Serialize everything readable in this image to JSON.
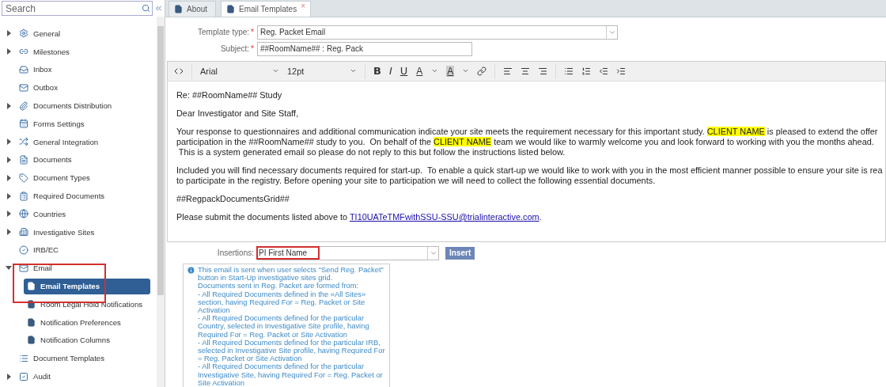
{
  "sidebar": {
    "search": {
      "placeholder": "Search"
    },
    "items": [
      {
        "label": "General",
        "expandable": true,
        "expanded": false,
        "selected": false
      },
      {
        "label": "Milestones",
        "expandable": true,
        "expanded": false,
        "selected": false
      },
      {
        "label": "Inbox",
        "expandable": false,
        "selected": false
      },
      {
        "label": "Outbox",
        "expandable": false,
        "selected": false
      },
      {
        "label": "Documents Distribution",
        "expandable": true,
        "expanded": false,
        "selected": false
      },
      {
        "label": "Forms Settings",
        "expandable": false,
        "selected": false
      },
      {
        "label": "General Integration",
        "expandable": true,
        "expanded": false,
        "selected": false
      },
      {
        "label": "Documents",
        "expandable": true,
        "expanded": false,
        "selected": false
      },
      {
        "label": "Document Types",
        "expandable": true,
        "expanded": false,
        "selected": false
      },
      {
        "label": "Required Documents",
        "expandable": true,
        "expanded": false,
        "selected": false
      },
      {
        "label": "Countries",
        "expandable": true,
        "expanded": false,
        "selected": false
      },
      {
        "label": "Investigative Sites",
        "expandable": true,
        "expanded": false,
        "selected": false
      },
      {
        "label": "IRB/EC",
        "expandable": false,
        "selected": false
      },
      {
        "label": "Email",
        "expandable": true,
        "expanded": true,
        "selected": false,
        "annotated": true,
        "children": [
          {
            "label": "Email Templates",
            "selected": true
          },
          {
            "label": "Room Legal Hold Notifications",
            "selected": false
          },
          {
            "label": "Notification Preferences",
            "selected": false
          },
          {
            "label": "Notification Columns",
            "selected": false
          }
        ]
      },
      {
        "label": "Document Templates",
        "expandable": false,
        "selected": false
      },
      {
        "label": "Audit",
        "expandable": true,
        "expanded": false,
        "selected": false
      }
    ]
  },
  "tabs": [
    {
      "label": "About",
      "selected": false,
      "closable": false
    },
    {
      "label": "Email Templates",
      "selected": true,
      "closable": true,
      "close": "×"
    }
  ],
  "form": {
    "template_type": {
      "label": "Template type:",
      "required": "*",
      "value": "Reg. Packet Email"
    },
    "subject": {
      "label": "Subject:",
      "required": "*",
      "value": "##RoomName## : Reg. Pack"
    }
  },
  "toolbar": {
    "font": "Arial",
    "size": "12pt",
    "bold": "B",
    "italic": "I",
    "underline": "U",
    "text_color": "A",
    "back_color": "A"
  },
  "body": [
    {
      "lines": [
        [
          {
            "text": "Re: ##RoomName## Study"
          }
        ]
      ]
    },
    {
      "lines": [
        [
          {
            "text": "Dear Investigator and Site Staff,"
          }
        ]
      ]
    },
    {
      "lines": [
        [
          {
            "text": "Your response to questionnaires and additional communication indicate your site meets the requirement necessary for this important study. "
          },
          {
            "text": "CLIENT NAME",
            "highlight": true
          },
          {
            "text": " is pleased to extend the offer"
          }
        ],
        [
          {
            "text": "participation in the ##RoomName## study to you.  On behalf of the "
          },
          {
            "text": "CLIENT NAME",
            "highlight": true
          },
          {
            "text": " team we would like to warmly welcome you and look forward to working with you the months ahead."
          }
        ],
        [
          {
            "text": " This is a system generated email so please do not reply to this but follow the instructions listed below."
          }
        ]
      ]
    },
    {
      "lines": [
        [
          {
            "text": "Included you will find necessary documents required for start-up.  To enable a quick start-up we would like to work with you in the most efficient manner possible to ensure your site is rea"
          }
        ],
        [
          {
            "text": "to participate in the registry. Before opening your site to participation we will need to collect the following essential documents."
          }
        ]
      ]
    },
    {
      "lines": [
        [
          {
            "text": "##RegpackDocumentsGrid##"
          }
        ]
      ]
    },
    {
      "lines": [
        [
          {
            "text": "Please submit the documents listed above to "
          },
          {
            "text": "TI10UATeTMFwithSSU-SSU@trialinteractive.com",
            "link": true
          },
          {
            "text": "."
          }
        ]
      ]
    }
  ],
  "insertions": {
    "label": "Insertions:",
    "value": "PI First Name",
    "annotated": true,
    "button": "Insert"
  },
  "info": "This email is sent when user selects \"Send Reg. Packet\" button in Start-Up investigative sites grid.\nDocuments sent in Reg. Packet are formed from:\n- All Required Documents defined in the «All Sites» section, having Required For = Reg. Packet or Site Activation\n- All Required Documents defined for the particular Country, selected in Investigative Site profile, having Required For = Reg. Packet or Site Activation\n- All Required Documents defined for the particular IRB, selected in Investigative Site profile, having Required For = Reg. Packet or Site Activation\n- All Required Documents defined for the particular Investigative Site, having Required For = Reg. Packet or Site Activation"
}
